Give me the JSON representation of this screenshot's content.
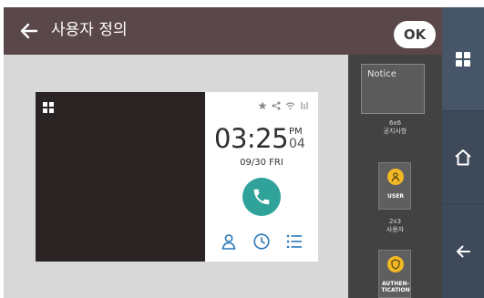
{
  "header": {
    "title": "사용자 정의",
    "ok_label": "OK"
  },
  "preview": {
    "time": "03:25",
    "ampm": "PM",
    "seconds": "04",
    "date": "09/30 FRI"
  },
  "widgets": {
    "notice_title": "Notice",
    "notice_size": "6x6",
    "notice_name": "공지사항",
    "user_tile_label": "USER",
    "user_size": "2x3",
    "user_name": "사용자",
    "auth_tile_label_1": "AUTHEN-",
    "auth_tile_label_2": "TICATION"
  },
  "colors": {
    "header_bg": "#5a474a",
    "accent_teal": "#2fa39a",
    "tile_yellow": "#f1b823",
    "nav_bg": "#3e4a5a"
  }
}
